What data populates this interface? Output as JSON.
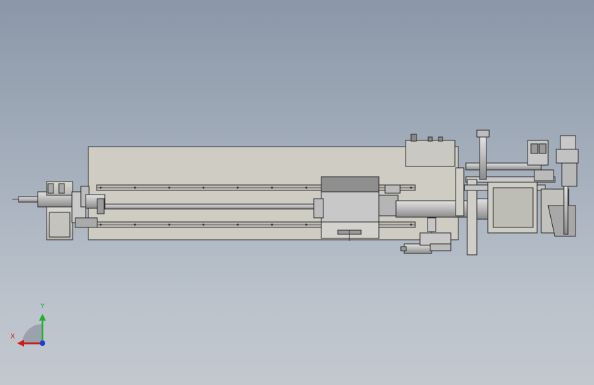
{
  "viewport": {
    "background_top": "#8b97a8",
    "background_bottom": "#c3c8cf"
  },
  "model": {
    "description_colors": {
      "body": "#cfcdc3",
      "metal": "#c8c8c8",
      "dark_metal": "#8f8f8f",
      "outline": "#2a2a2a"
    }
  },
  "triad": {
    "x_label": "X",
    "y_label": "Y",
    "x_color": "#d11a1a",
    "y_color": "#1fae2e",
    "z_color": "#1a3fd1"
  }
}
